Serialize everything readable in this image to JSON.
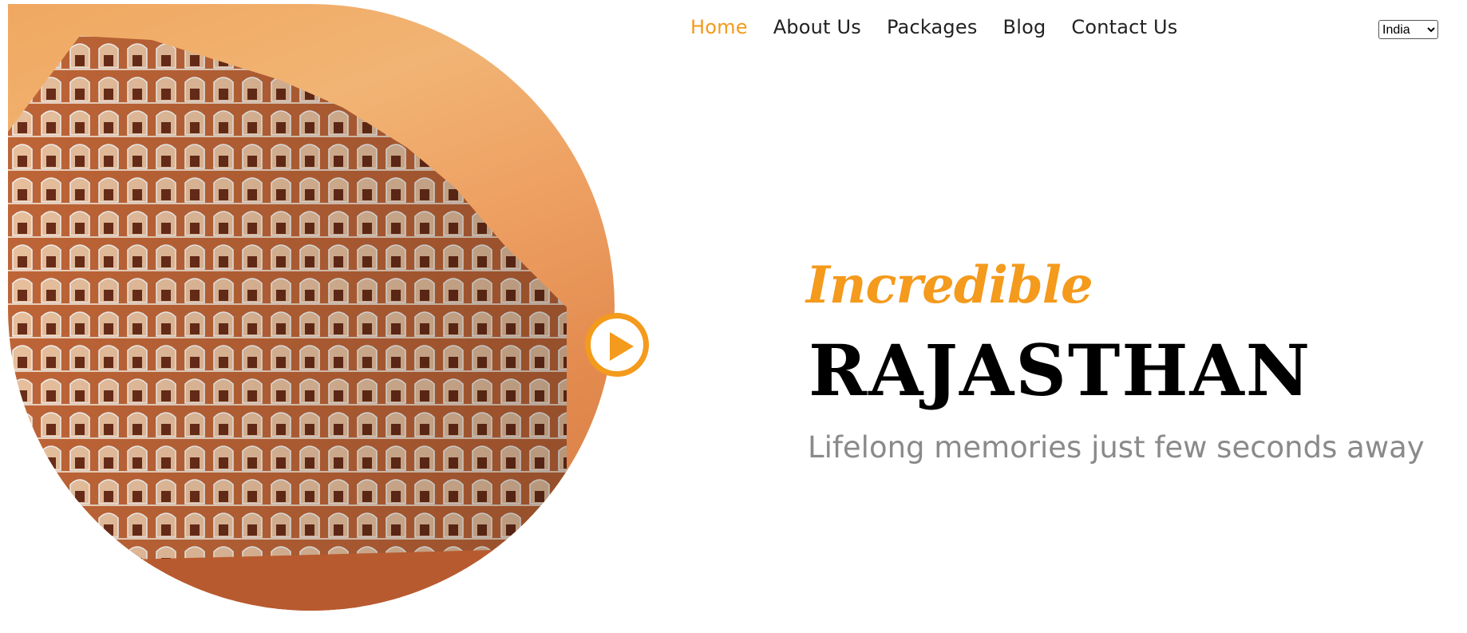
{
  "nav": {
    "items": [
      {
        "label": "Home",
        "active": true
      },
      {
        "label": "About Us",
        "active": false
      },
      {
        "label": "Packages",
        "active": false
      },
      {
        "label": "Blog",
        "active": false
      },
      {
        "label": "Contact Us",
        "active": false
      }
    ]
  },
  "country_select": {
    "selected": "India",
    "options": [
      "India"
    ]
  },
  "hero": {
    "kicker": "Incredible",
    "title": "RAJASTHAN",
    "subtitle": "Lifelong memories just few seconds away"
  },
  "colors": {
    "accent": "#f49a1c",
    "title": "#000000",
    "subtitle": "#8a8a8a",
    "nav_text": "#222222"
  },
  "icons": {
    "play": "play-icon"
  }
}
